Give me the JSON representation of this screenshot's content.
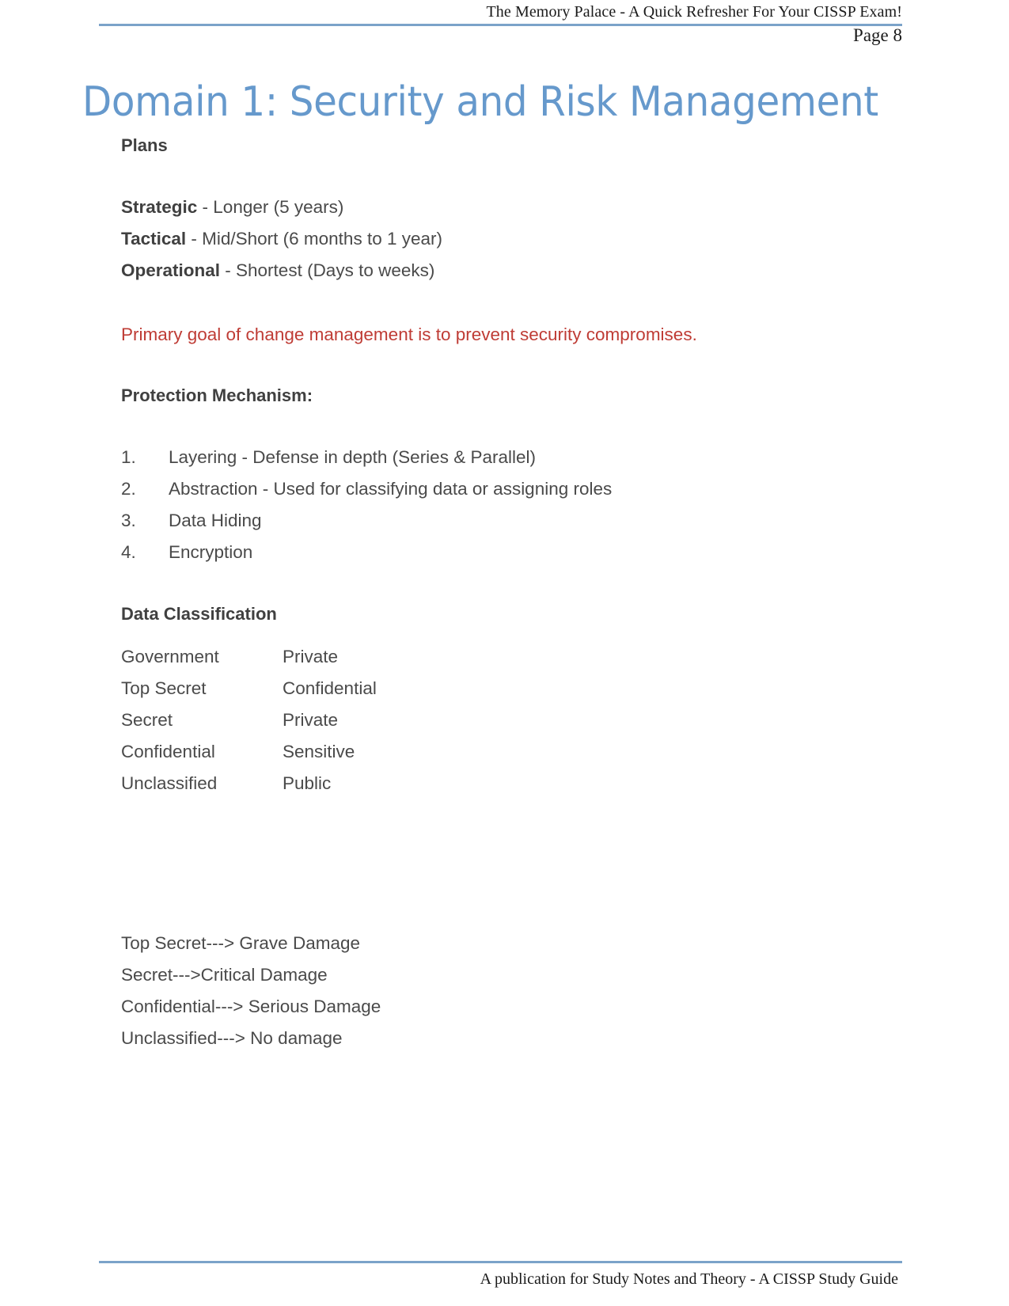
{
  "header": {
    "title": "The Memory Palace - A Quick Refresher For Your CISSP Exam!",
    "page_number": "Page 8",
    "rule_color": "#7ba3c9"
  },
  "title": {
    "text": "Domain 1: Security and Risk Management",
    "color": "#6699cc"
  },
  "sections": {
    "plans_heading": "Plans",
    "plans": [
      {
        "term": "Strategic",
        "detail": " - Longer (5 years)"
      },
      {
        "term": "Tactical",
        "detail": " - Mid/Short (6 months to 1 year)"
      },
      {
        "term": "Operational",
        "detail": " - Shortest (Days to weeks)"
      }
    ],
    "highlight": {
      "text": "Primary goal of change management is to prevent security compromises.",
      "color": "#bf3c35"
    },
    "protection_heading": "Protection Mechanism:",
    "protection_items": [
      {
        "num": "1.",
        "label": "Layering - Defense in depth (Series & Parallel)"
      },
      {
        "num": "2.",
        "label": "Abstraction - Used for classifying data or assigning roles"
      },
      {
        "num": "3.",
        "label": "Data Hiding"
      },
      {
        "num": "4.",
        "label": "Encryption"
      }
    ],
    "classification_heading": "Data Classification",
    "classification_rows": [
      {
        "government": "Government",
        "private": "Private"
      },
      {
        "government": "Top Secret",
        "private": "Confidential"
      },
      {
        "government": "Secret",
        "private": "Private"
      },
      {
        "government": "Confidential",
        "private": "Sensitive"
      },
      {
        "government": "Unclassified",
        "private": "Public"
      }
    ],
    "damage_lines": [
      "Top Secret---> Grave Damage",
      "Secret--->Critical Damage",
      "Confidential---> Serious Damage",
      "Unclassified---> No damage"
    ]
  },
  "footer": {
    "text": "A publication for Study Notes and Theory - A CISSP Study Guide",
    "rule_color": "#7ba3c9"
  }
}
